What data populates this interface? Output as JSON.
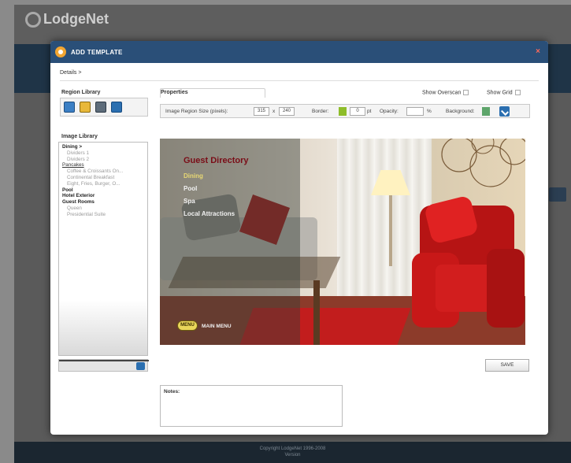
{
  "background": {
    "logo": "LodgeNet",
    "footer_line1": "Copyright LodgeNet 1996-2008",
    "footer_line2": "Version"
  },
  "modal": {
    "title": "ADD TEMPLATE",
    "close": "×",
    "breadcrumb": "Details  >"
  },
  "region_library": {
    "label": "Region Library",
    "tools": [
      "text-tool-icon",
      "image-tool-icon",
      "video-tool-icon",
      "link-tool-icon"
    ]
  },
  "image_library": {
    "label": "Image Library",
    "items": [
      {
        "text": "Dining  >",
        "kind": "cat"
      },
      {
        "text": "Dividers 1",
        "kind": "sub"
      },
      {
        "text": "Dividers 2",
        "kind": "sub"
      },
      {
        "text": "Pancakes",
        "kind": "sel"
      },
      {
        "text": "Coffee & Croissants On...",
        "kind": "sub"
      },
      {
        "text": "Continental Breakfast",
        "kind": "sub"
      },
      {
        "text": "Eight, Fries, Burger, O...",
        "kind": "sub"
      },
      {
        "text": "Pool",
        "kind": "cat"
      },
      {
        "text": "Hotel Exterior",
        "kind": "cat"
      },
      {
        "text": "Guest Rooms",
        "kind": "cat"
      },
      {
        "text": "Queen",
        "kind": "sub"
      },
      {
        "text": "Presidential Suite",
        "kind": "sub"
      }
    ]
  },
  "properties": {
    "label": "Properties",
    "show_overscan": "Show Overscan",
    "show_grid": "Show Grid",
    "size_label": "Image Region Size (pixels):",
    "width": "315",
    "x": "x",
    "height": "240",
    "border_label": "Border:",
    "border_value": "0",
    "border_unit": "pt",
    "opacity_label": "Opacity:",
    "opacity_value": "",
    "opacity_unit": "%",
    "background_label": "Background:",
    "colors": {
      "border": "#8ebd2a",
      "background": "#5ea56b",
      "accent": "#2b6fb0"
    }
  },
  "preview": {
    "title": "Guest Directory",
    "items": [
      "Dining",
      "Pool",
      "Spa",
      "Local Attractions"
    ],
    "badge": "MENU",
    "main_menu": "MAIN MENU"
  },
  "save_label": "SAVE",
  "notes_label": "Notes:"
}
